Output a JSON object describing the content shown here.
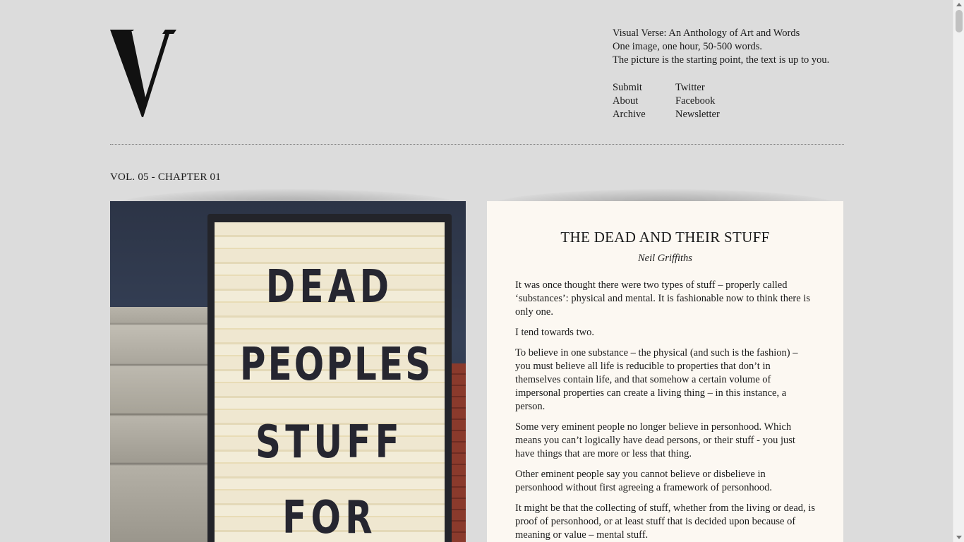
{
  "site": {
    "logo_letter": "V",
    "intro": [
      "Visual Verse: An Anthology of Art and Words",
      "One image, one hour, 50-500 words.",
      "The picture is the starting point, the text is up to you."
    ]
  },
  "nav": {
    "left": [
      "Submit",
      "About",
      "Archive"
    ],
    "right": [
      "Twitter",
      "Facebook",
      "Newsletter"
    ]
  },
  "chapter": {
    "label": "VOL. 05 - CHAPTER 01"
  },
  "image": {
    "sign_lines": [
      "DEAD",
      "PEOPLES",
      "STUFF",
      "FOR"
    ]
  },
  "story": {
    "title": "THE DEAD AND THEIR STUFF",
    "author": "Neil Griffiths",
    "paragraphs": [
      "It was once thought there were two types of stuff – properly called ‘substances’: physical and mental. It is fashionable now to think there is only one.",
      "I tend towards two.",
      "To believe in one substance – the physical (and such is the fashion) – you must believe all life is reducible to properties that don’t in themselves contain life, and that somehow a certain volume of impersonal properties can create a living thing – in this instance, a person.",
      "Some very eminent people no longer believe in personhood. Which means you can’t logically have dead persons, or their stuff - you just have things that are more or less that thing.",
      "Other eminent people say you cannot believe or disbelieve in personhood without first agreeing a framework of personhood.",
      "It might be that the collecting of stuff, whether from the living or dead, is proof of personhood, or at least stuff that is decided upon because of meaning or value – mental stuff."
    ],
    "separator": "*"
  }
}
